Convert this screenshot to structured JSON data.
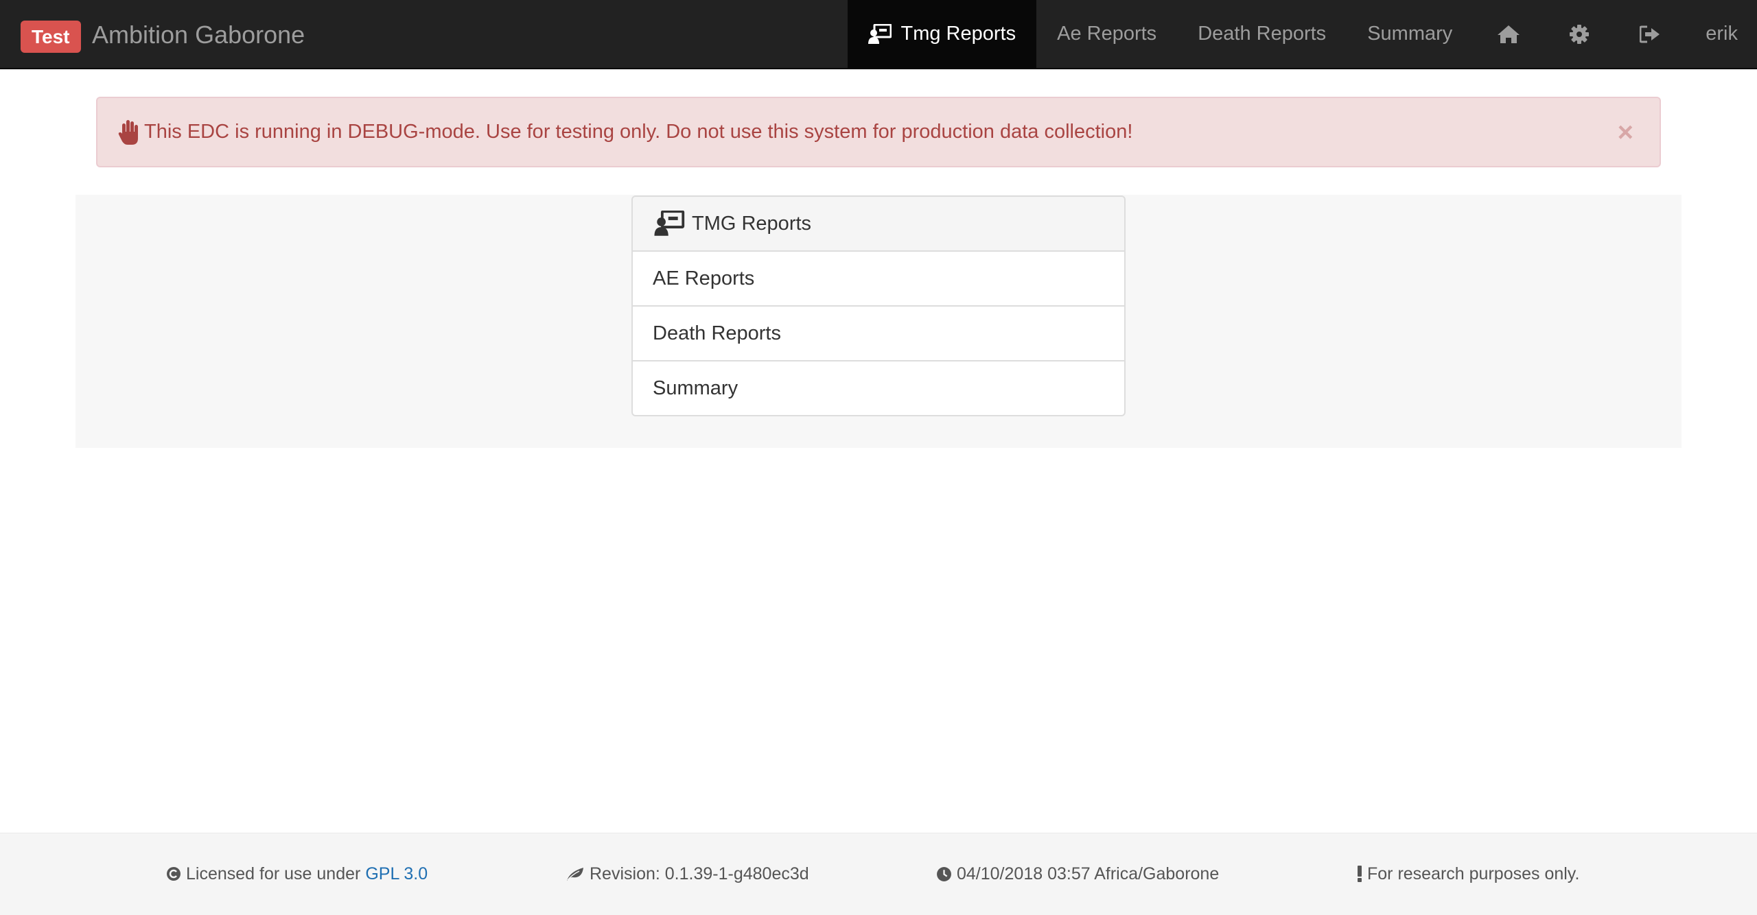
{
  "navbar": {
    "badge": "Test",
    "brand": "Ambition Gaborone",
    "items": [
      {
        "label": "Tmg Reports",
        "icon": "report-user-icon",
        "active": true
      },
      {
        "label": "Ae Reports"
      },
      {
        "label": "Death Reports"
      },
      {
        "label": "Summary"
      }
    ],
    "icons": [
      "home-icon",
      "gear-icon",
      "logout-icon"
    ],
    "user": "erik"
  },
  "alert": {
    "icon": "hand-stop-icon",
    "text": "This EDC is running in DEBUG-mode. Use for testing only. Do not use this system for production data collection!",
    "close": "×"
  },
  "panel": {
    "header": "TMG Reports",
    "header_icon": "report-user-icon",
    "items": [
      "AE Reports",
      "Death Reports",
      "Summary"
    ]
  },
  "footer": {
    "license_text": "Licensed for use under",
    "license_link": "GPL 3.0",
    "revision": "Revision: 0.1.39-1-g480ec3d",
    "datetime": "04/10/2018 03:57 Africa/Gaborone",
    "research": "For research purposes only."
  },
  "colors": {
    "navbar_bg": "#222222",
    "navbar_active_bg": "#080808",
    "badge_bg": "#d9534f",
    "alert_bg": "#f2dede",
    "alert_text": "#a94442",
    "link": "#1f6fb2"
  }
}
